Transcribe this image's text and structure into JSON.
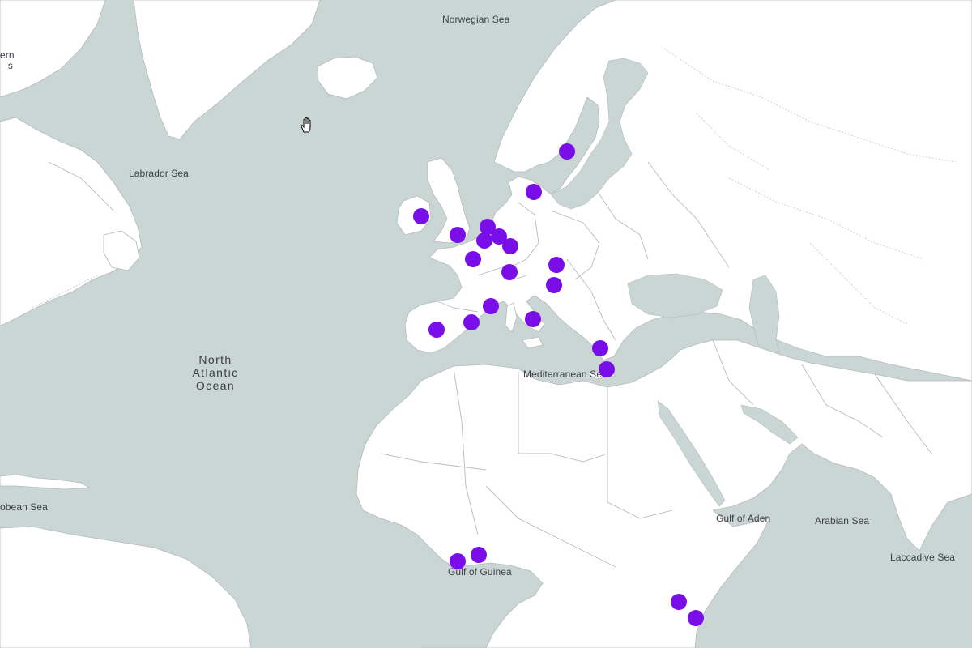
{
  "map": {
    "marker_color": "#7a0ee8",
    "ocean_color": "#c9d6d4",
    "land_color": "#ffffff",
    "labels": [
      {
        "id": "norwegian-sea",
        "text": "Norwegian Sea"
      },
      {
        "id": "labrador-sea",
        "text": "Labrador Sea"
      },
      {
        "id": "north-atlantic-ocean",
        "text": "North\nAtlantic\nOcean"
      },
      {
        "id": "mediterranean-sea",
        "text": "Mediterranean Sea"
      },
      {
        "id": "gulf-of-aden",
        "text": "Gulf of Aden"
      },
      {
        "id": "arabian-sea",
        "text": "Arabian Sea"
      },
      {
        "id": "laccadive-sea",
        "text": "Laccadive Sea"
      },
      {
        "id": "gulf-of-guinea",
        "text": "Gulf of Guinea"
      },
      {
        "id": "caribbean-sea-partial",
        "text": "obean Sea"
      },
      {
        "id": "northern-partial",
        "text": "ern\ns"
      }
    ],
    "marker_count": 24
  }
}
